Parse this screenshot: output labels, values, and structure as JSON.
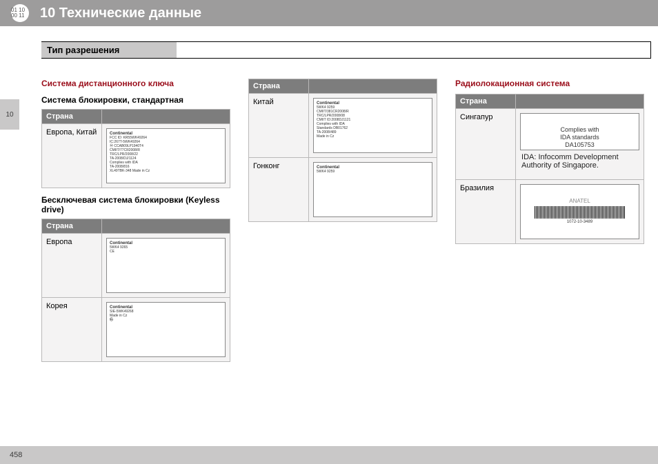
{
  "header": {
    "icon_label": "01 10\n00 11",
    "title": "10 Технические данные"
  },
  "side_tab": "10",
  "page_number": "458",
  "section_title": "Тип разрешения",
  "col1": {
    "heading": "Система дистанционного ключа",
    "sub1": "Система блокировки, стандартная",
    "table1_header": "Страна",
    "table1_rows": [
      {
        "country": "Европа, Китай",
        "label_brand": "Continental",
        "label_lines": "FCC ID: KR55WK49264\nIC:267T-5WK49264\nⓂ CCAB09LP1940T4\nCMIIT/77CR2008/R\nTRC/LPR/2008/22\nTA-2008/DJ/1124\nComplies with IDA\nTA-2008/816\nXL49TBK-348  Made in Cz"
      }
    ],
    "sub2": "Бесключевая система блокировки (Keyless drive)",
    "table2_header": "Страна",
    "table2_rows": [
      {
        "country": "Европа",
        "label_brand": "Continental",
        "label_lines": "5WK4 9265\nCE"
      },
      {
        "country": "Корея",
        "label_brand": "Continental",
        "label_lines": "SIE-5WK49268\nMade in Cz\n㉿"
      }
    ]
  },
  "col2": {
    "table_header": "Страна",
    "rows": [
      {
        "country": "Китай",
        "label_brand": "Continental",
        "label_lines": "5WK4 9259\nCMIIT/381CR2008/R\nTRC/LPR/2008/08\nCMIIT ID:2008DJ1121\nComplies with IDA\nStandards DB01762\nTA-2008/489\nMade in Cz"
      },
      {
        "country": "Гонконг",
        "label_brand": "Continental",
        "label_lines": "5WK4 9259"
      }
    ]
  },
  "col3": {
    "heading": "Радиолокационная система",
    "table_header": "Страна",
    "rows": [
      {
        "country": "Сингапур",
        "label_ida": "Complies with\nIDA standards\nDA105753",
        "note": "IDA: Infocomm Development Authority of Singapore."
      },
      {
        "country": "Бразилия",
        "anatel_name": "ANATEL",
        "anatel_sub": "1072-10-3489"
      }
    ]
  }
}
